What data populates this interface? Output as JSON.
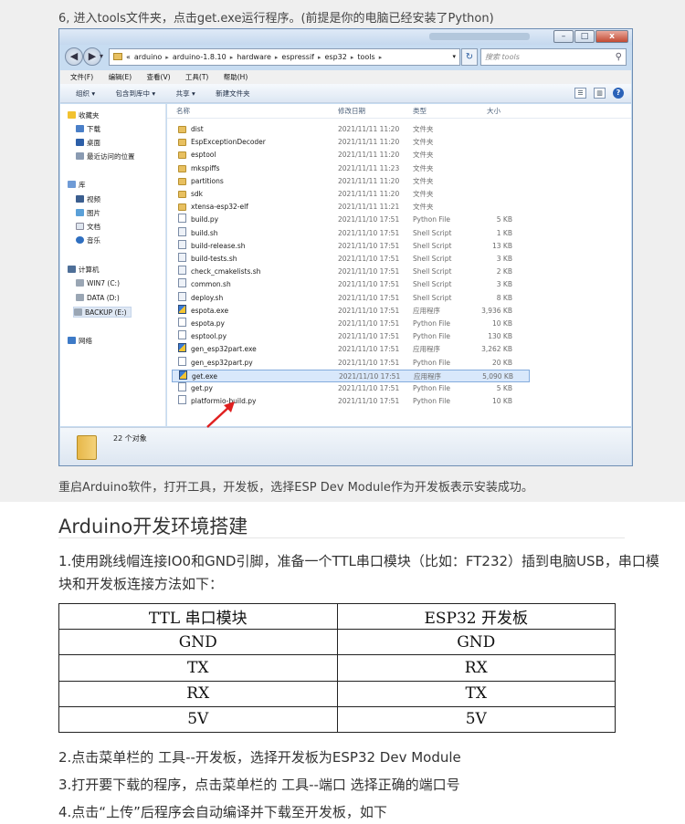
{
  "step6_text": "6, 进入tools文件夹，点击get.exe运行程序。(前提是你的电脑已经安装了Python)",
  "explorer": {
    "title_buttons": {
      "minimize": "–",
      "maximize": "□",
      "close": "x"
    },
    "back_icon": "arrow-left-icon",
    "forward_icon": "arrow-right-icon",
    "address": {
      "prefix": "«",
      "segments": [
        "arduino",
        "arduino-1.8.10",
        "hardware",
        "espressif",
        "esp32",
        "tools"
      ]
    },
    "search_placeholder": "搜索 tools",
    "menu": [
      "文件(F)",
      "编辑(E)",
      "查看(V)",
      "工具(T)",
      "帮助(H)"
    ],
    "toolbar": [
      "组织 ▾",
      "包含到库中 ▾",
      "共享 ▾",
      "新建文件夹"
    ],
    "nav": {
      "favorites": "收藏夹",
      "download": "下载",
      "desktop": "桌面",
      "recent": "最近访问的位置",
      "libraries": "库",
      "videos": "视频",
      "pictures": "图片",
      "documents": "文档",
      "music": "音乐",
      "computer": "计算机",
      "drive_c": "WIN7 (C:)",
      "drive_d": "DATA (D:)",
      "drive_e": "BACKUP (E:)",
      "network": "网络"
    },
    "columns": {
      "name": "名称",
      "date": "修改日期",
      "type": "类型",
      "size": "大小"
    },
    "files": [
      {
        "name": "dist",
        "date": "2021/11/11 11:20",
        "type": "文件夹",
        "size": "",
        "icon": "folder"
      },
      {
        "name": "EspExceptionDecoder",
        "date": "2021/11/11 11:20",
        "type": "文件夹",
        "size": "",
        "icon": "folder"
      },
      {
        "name": "esptool",
        "date": "2021/11/11 11:20",
        "type": "文件夹",
        "size": "",
        "icon": "folder"
      },
      {
        "name": "mkspiffs",
        "date": "2021/11/11 11:23",
        "type": "文件夹",
        "size": "",
        "icon": "folder"
      },
      {
        "name": "partitions",
        "date": "2021/11/11 11:20",
        "type": "文件夹",
        "size": "",
        "icon": "folder"
      },
      {
        "name": "sdk",
        "date": "2021/11/11 11:20",
        "type": "文件夹",
        "size": "",
        "icon": "folder"
      },
      {
        "name": "xtensa-esp32-elf",
        "date": "2021/11/11 11:21",
        "type": "文件夹",
        "size": "",
        "icon": "folder"
      },
      {
        "name": "build.py",
        "date": "2021/11/10 17:51",
        "type": "Python File",
        "size": "5 KB",
        "icon": "py"
      },
      {
        "name": "build.sh",
        "date": "2021/11/10 17:51",
        "type": "Shell Script",
        "size": "1 KB",
        "icon": "sh"
      },
      {
        "name": "build-release.sh",
        "date": "2021/11/10 17:51",
        "type": "Shell Script",
        "size": "13 KB",
        "icon": "sh"
      },
      {
        "name": "build-tests.sh",
        "date": "2021/11/10 17:51",
        "type": "Shell Script",
        "size": "3 KB",
        "icon": "sh"
      },
      {
        "name": "check_cmakelists.sh",
        "date": "2021/11/10 17:51",
        "type": "Shell Script",
        "size": "2 KB",
        "icon": "sh"
      },
      {
        "name": "common.sh",
        "date": "2021/11/10 17:51",
        "type": "Shell Script",
        "size": "3 KB",
        "icon": "sh"
      },
      {
        "name": "deploy.sh",
        "date": "2021/11/10 17:51",
        "type": "Shell Script",
        "size": "8 KB",
        "icon": "sh"
      },
      {
        "name": "espota.exe",
        "date": "2021/11/10 17:51",
        "type": "应用程序",
        "size": "3,936 KB",
        "icon": "exe"
      },
      {
        "name": "espota.py",
        "date": "2021/11/10 17:51",
        "type": "Python File",
        "size": "10 KB",
        "icon": "py"
      },
      {
        "name": "esptool.py",
        "date": "2021/11/10 17:51",
        "type": "Python File",
        "size": "130 KB",
        "icon": "py"
      },
      {
        "name": "gen_esp32part.exe",
        "date": "2021/11/10 17:51",
        "type": "应用程序",
        "size": "3,262 KB",
        "icon": "exe"
      },
      {
        "name": "gen_esp32part.py",
        "date": "2021/11/10 17:51",
        "type": "Python File",
        "size": "20 KB",
        "icon": "py"
      },
      {
        "name": "get.exe",
        "date": "2021/11/10 17:51",
        "type": "应用程序",
        "size": "5,090 KB",
        "icon": "exe",
        "selected": true
      },
      {
        "name": "get.py",
        "date": "2021/11/10 17:51",
        "type": "Python File",
        "size": "5 KB",
        "icon": "py"
      },
      {
        "name": "platformio-build.py",
        "date": "2021/11/10 17:51",
        "type": "Python File",
        "size": "10 KB",
        "icon": "py"
      }
    ],
    "item_count": "22 个对象"
  },
  "restart_text": "重启Arduino软件，打开工具，开发板，选择ESP Dev Module作为开发板表示安装成功。",
  "section_title": "Arduino开发环境搭建",
  "para1": "1.使用跳线帽连接IO0和GND引脚，准备一个TTL串口模块（比如：FT232）插到电脑USB，串口模块和开发板连接方法如下：",
  "table": {
    "headers": [
      "TTL 串口模块",
      "ESP32 开发板"
    ],
    "rows": [
      [
        "GND",
        "GND"
      ],
      [
        "TX",
        "RX"
      ],
      [
        "RX",
        "TX"
      ],
      [
        "5V",
        "5V"
      ]
    ]
  },
  "para2": "2.点击菜单栏的 工具--开发板，选择开发板为ESP32 Dev Module",
  "para3": "3.打开要下载的程序，点击菜单栏的 工具--端口 选择正确的端口号",
  "para4": "4.点击“上传”后程序会自动编译并下载至开发板，如下",
  "colors": {
    "band": "#efefef",
    "window_frame": "#c7dcf1",
    "selection": "#d9e8fb",
    "arrow": "#e02020"
  }
}
